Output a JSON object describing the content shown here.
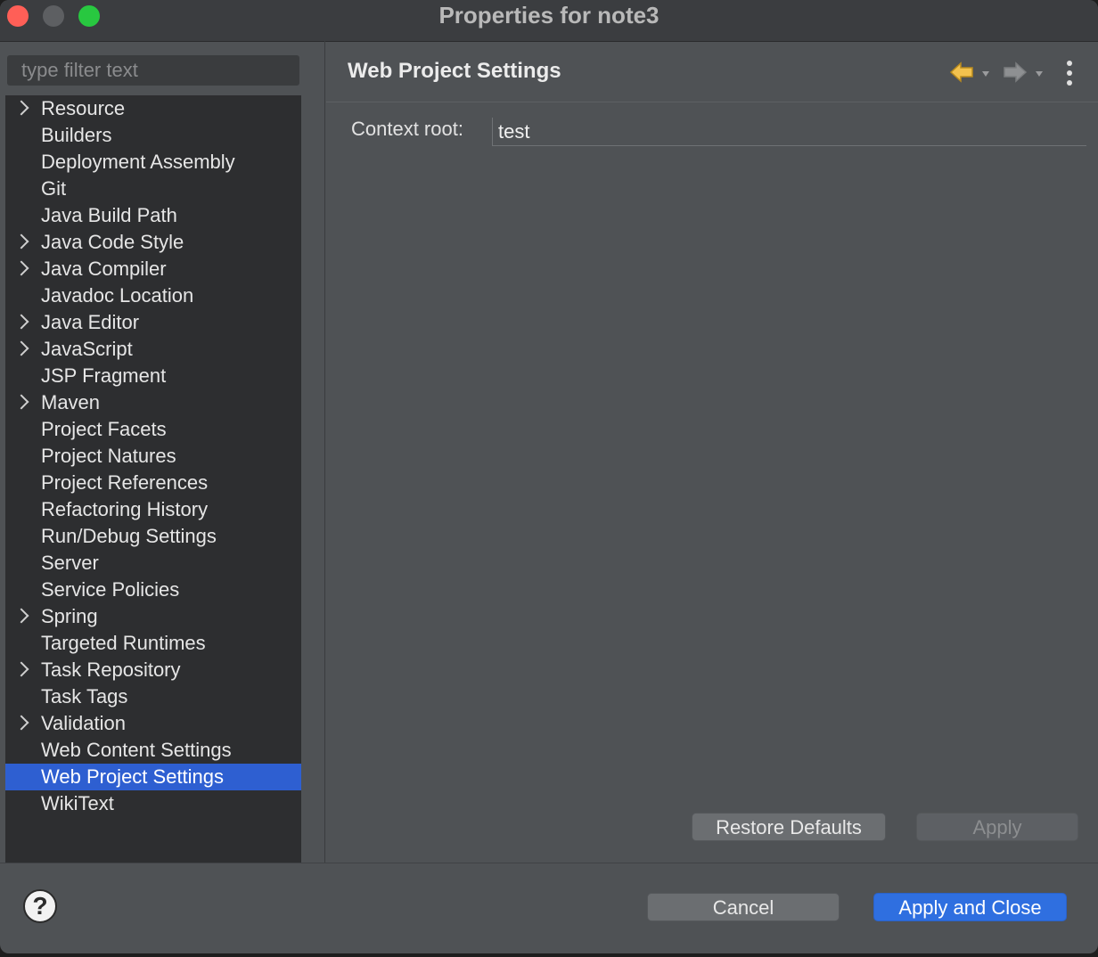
{
  "window": {
    "title": "Properties for note3"
  },
  "sidebar": {
    "filter_placeholder": "type filter text",
    "items": [
      {
        "label": "Resource",
        "expandable": true
      },
      {
        "label": "Builders",
        "expandable": false
      },
      {
        "label": "Deployment Assembly",
        "expandable": false
      },
      {
        "label": "Git",
        "expandable": false
      },
      {
        "label": "Java Build Path",
        "expandable": false
      },
      {
        "label": "Java Code Style",
        "expandable": true
      },
      {
        "label": "Java Compiler",
        "expandable": true
      },
      {
        "label": "Javadoc Location",
        "expandable": false
      },
      {
        "label": "Java Editor",
        "expandable": true
      },
      {
        "label": "JavaScript",
        "expandable": true
      },
      {
        "label": "JSP Fragment",
        "expandable": false
      },
      {
        "label": "Maven",
        "expandable": true
      },
      {
        "label": "Project Facets",
        "expandable": false
      },
      {
        "label": "Project Natures",
        "expandable": false
      },
      {
        "label": "Project References",
        "expandable": false
      },
      {
        "label": "Refactoring History",
        "expandable": false
      },
      {
        "label": "Run/Debug Settings",
        "expandable": false
      },
      {
        "label": "Server",
        "expandable": false
      },
      {
        "label": "Service Policies",
        "expandable": false
      },
      {
        "label": "Spring",
        "expandable": true
      },
      {
        "label": "Targeted Runtimes",
        "expandable": false
      },
      {
        "label": "Task Repository",
        "expandable": true
      },
      {
        "label": "Task Tags",
        "expandable": false
      },
      {
        "label": "Validation",
        "expandable": true
      },
      {
        "label": "Web Content Settings",
        "expandable": false
      },
      {
        "label": "Web Project Settings",
        "expandable": false,
        "selected": true
      },
      {
        "label": "WikiText",
        "expandable": false
      }
    ]
  },
  "page": {
    "title": "Web Project Settings",
    "context_root_label": "Context root:",
    "context_root_value": "test",
    "nav_icons": [
      "back-arrow-icon",
      "forward-arrow-icon",
      "more-vertical-icon"
    ],
    "restore_defaults_label": "Restore Defaults",
    "apply_label": "Apply"
  },
  "footer": {
    "help_icon": "help-icon",
    "cancel_label": "Cancel",
    "apply_close_label": "Apply and Close"
  },
  "colors": {
    "selection": "#2e5fd1",
    "primary_button": "#2f6fe0",
    "back_arrow": "#f2c14e"
  }
}
